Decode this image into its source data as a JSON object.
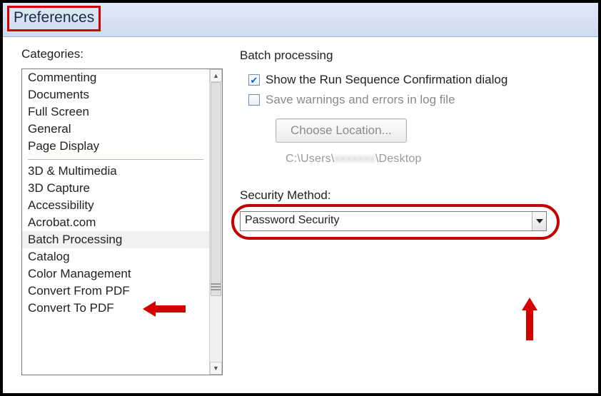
{
  "window": {
    "title": "Preferences"
  },
  "left": {
    "heading": "Categories:",
    "group1": [
      "Commenting",
      "Documents",
      "Full Screen",
      "General",
      "Page Display"
    ],
    "group2": [
      "3D & Multimedia",
      "3D Capture",
      "Accessibility",
      "Acrobat.com",
      "Batch Processing",
      "Catalog",
      "Color Management",
      "Convert From PDF",
      "Convert To PDF"
    ],
    "selected": "Batch Processing"
  },
  "right": {
    "heading": "Batch processing",
    "check1": "Show the Run Sequence Confirmation dialog",
    "check2": "Save warnings and errors in log file",
    "choose_btn": "Choose Location...",
    "path_prefix": "C:\\Users\\",
    "path_hidden": "xxxxxxx",
    "path_suffix": "\\Desktop",
    "security_label": "Security Method:",
    "security_value": "Password Security"
  }
}
